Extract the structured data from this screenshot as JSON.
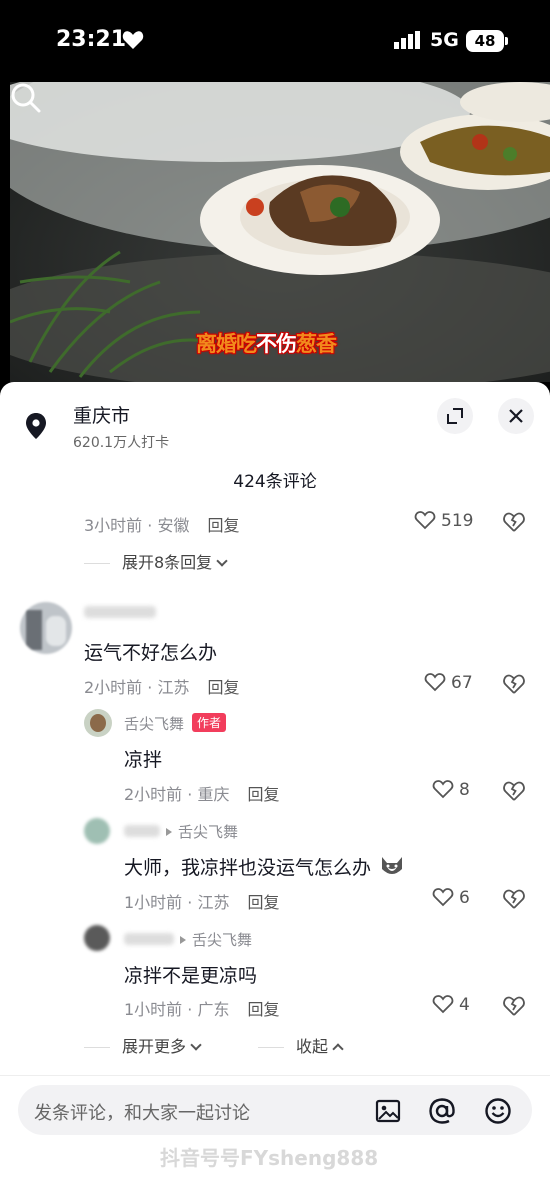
{
  "status": {
    "time": "23:21",
    "network": "5G",
    "battery": "48"
  },
  "video": {
    "caption_a": "离婚吃",
    "caption_b": "不伤",
    "caption_c": "葱香"
  },
  "location": {
    "name": "重庆市",
    "stats": "620.1万人打卡"
  },
  "comments_header": "424条评论",
  "prev_comment": {
    "meta": "3小时前 · 安徽",
    "reply": "回复",
    "likes": "519",
    "expand": "展开8条回复"
  },
  "comment": {
    "text": "运气不好怎么办",
    "meta": "2小时前 · 江苏",
    "reply": "回复",
    "likes": "67"
  },
  "replies": [
    {
      "user": "舌尖飞舞",
      "tag": "作者",
      "text": "凉拌",
      "meta": "2小时前 · 重庆",
      "reply": "回复",
      "likes": "8"
    },
    {
      "to": "舌尖飞舞",
      "text": "大师，我凉拌也没运气怎么办",
      "meta": "1小时前 · 江苏",
      "reply": "回复",
      "likes": "6"
    },
    {
      "to": "舌尖飞舞",
      "text": "凉拌不是更凉吗",
      "meta": "1小时前 · 广东",
      "reply": "回复",
      "likes": "4"
    }
  ],
  "expand_more": "展开更多",
  "collapse": "收起",
  "input": {
    "placeholder": "发条评论，和大家一起讨论"
  },
  "watermark": "抖音号号FYsheng888",
  "colors": {
    "author_tag": "#f23d5c",
    "caption_highlight": "#f28a1c"
  },
  "icons": [
    "heart-icon",
    "search-icon",
    "location-pin-icon",
    "expand-icon",
    "close-icon",
    "like-icon",
    "dislike-icon",
    "image-icon",
    "at-icon",
    "emoji-icon"
  ]
}
